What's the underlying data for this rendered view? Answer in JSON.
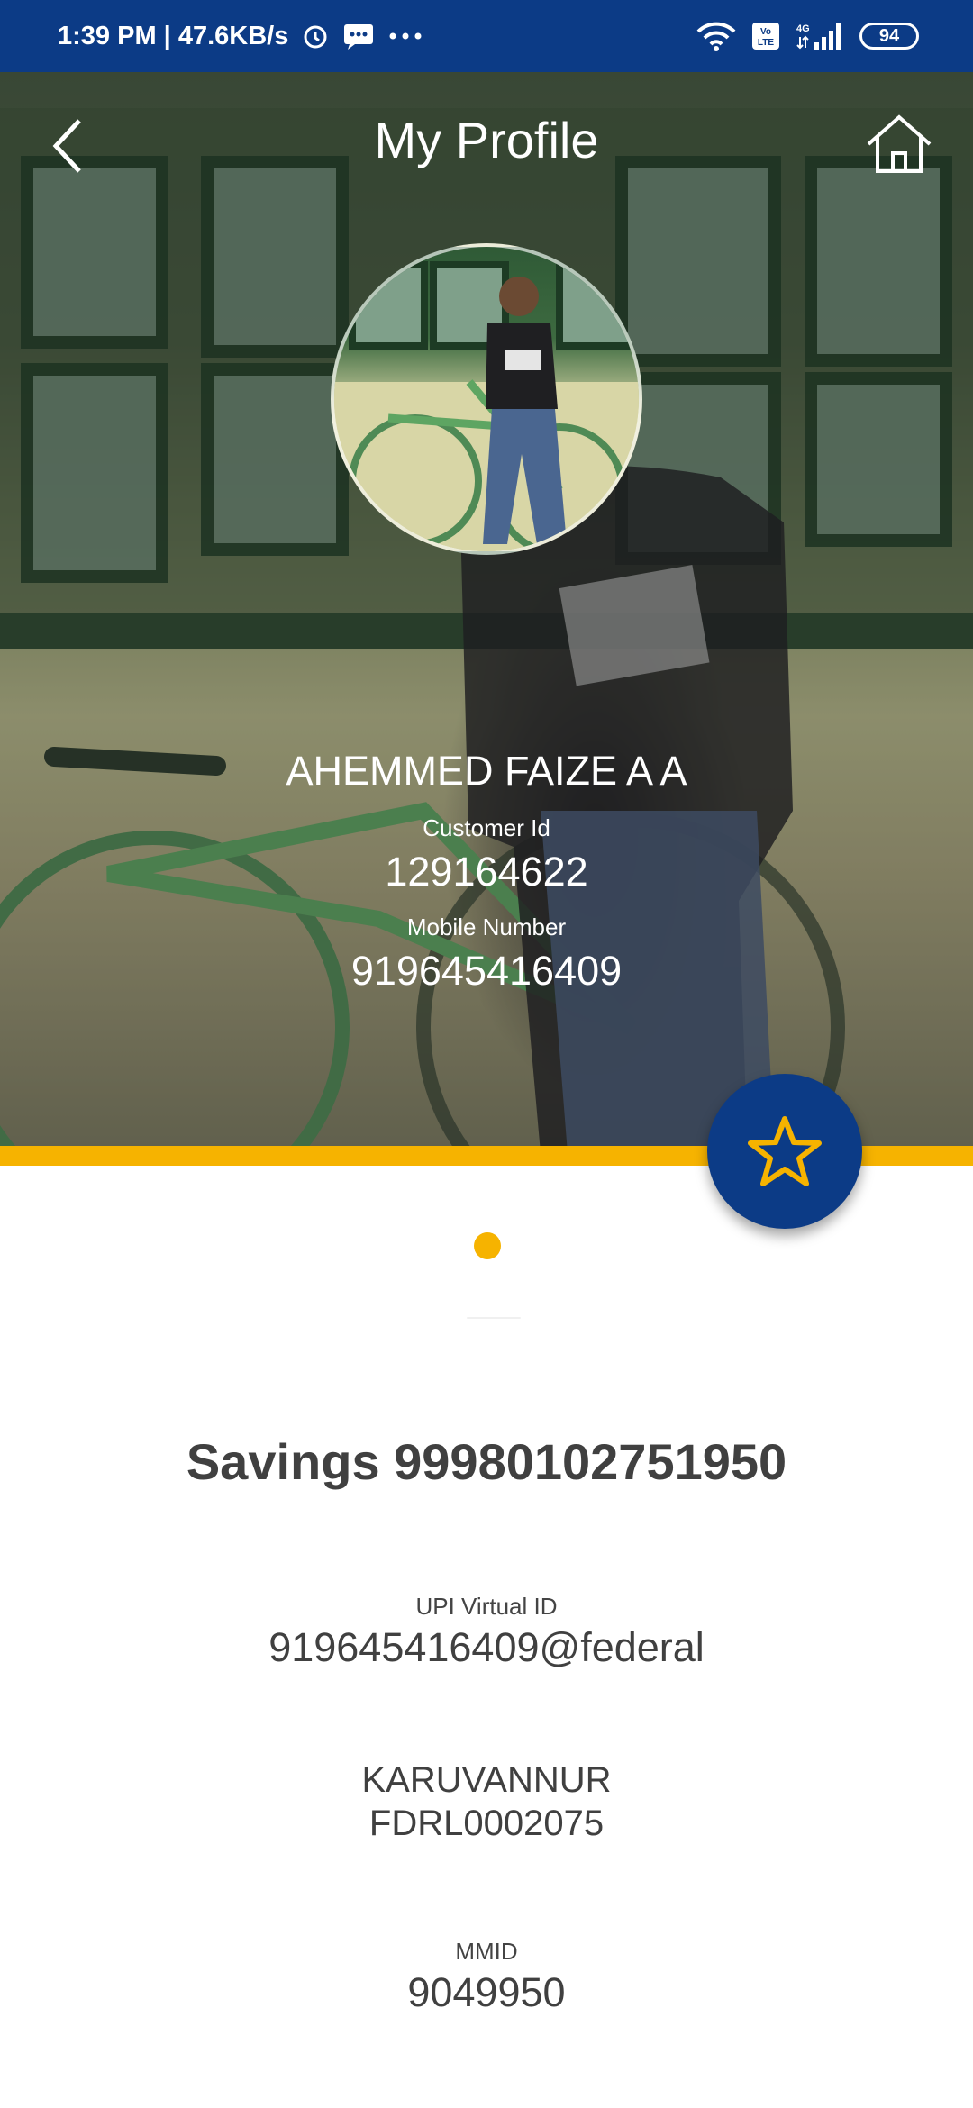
{
  "status_bar": {
    "time_speed": "1:39 PM | 47.6KB/s",
    "battery": "94",
    "network": "4G"
  },
  "header": {
    "title": "My Profile"
  },
  "profile": {
    "name": "AHEMMED FAIZE A A",
    "customer_id_label": "Customer Id",
    "customer_id": "129164622",
    "mobile_label": "Mobile Number",
    "mobile": "919645416409"
  },
  "account": {
    "title": "Savings 99980102751950",
    "upi_label": "UPI Virtual ID",
    "upi_id": "919645416409@federal",
    "branch_name": "KARUVANNUR",
    "ifsc": "FDRL0002075",
    "mmid_label": "MMID",
    "mmid": "9049950"
  },
  "carousel": {
    "current_page": 1,
    "total_pages": 1
  },
  "colors": {
    "brand_blue": "#0c3b86",
    "accent_gold": "#f6b300",
    "text_dark": "#404040"
  },
  "icons": {
    "back": "back-chevron-icon",
    "home": "home-icon",
    "favorite": "star-icon",
    "alarm": "alarm-icon",
    "message": "message-icon",
    "more": "more-dots-icon",
    "wifi": "wifi-icon",
    "volte": "volte-icon",
    "signal": "signal-icon",
    "battery": "battery-icon"
  }
}
